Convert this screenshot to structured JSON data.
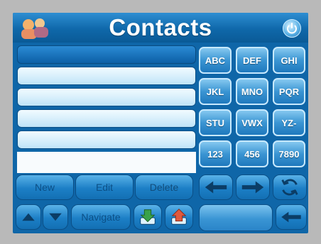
{
  "header": {
    "title": "Contacts",
    "left_icon": "people-icon",
    "right_icon": "power-icon"
  },
  "contact_list": {
    "rows": [
      "",
      "",
      "",
      "",
      "",
      ""
    ],
    "selected_index": 0
  },
  "keypad": {
    "keys": [
      "ABC",
      "DEF",
      "GHI",
      "JKL",
      "MNO",
      "PQR",
      "STU",
      "VWX",
      "YZ-",
      "123",
      "456",
      "7890"
    ]
  },
  "actions": {
    "new_label": "New",
    "edit_label": "Edit",
    "delete_label": "Delete",
    "navigate_label": "Navigate"
  },
  "colors": {
    "background": "#0f66a8",
    "title_text": "#ffffff",
    "accent": "#2e8ed2"
  }
}
